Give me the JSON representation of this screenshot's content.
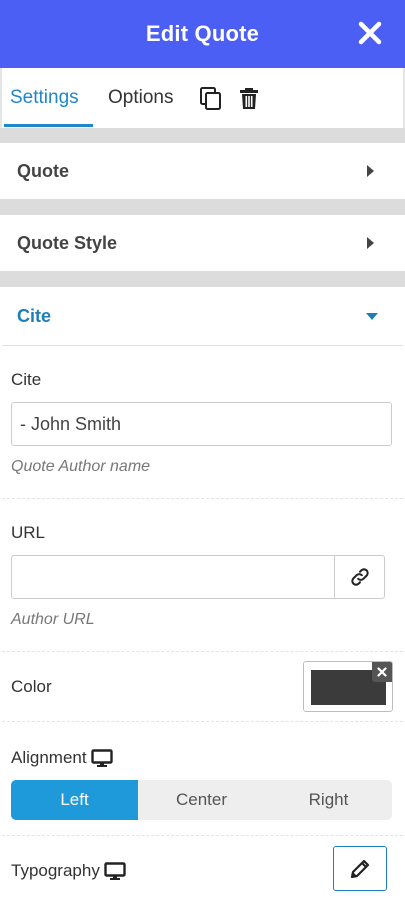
{
  "header": {
    "title": "Edit Quote",
    "close_icon": "close-icon"
  },
  "tabs": {
    "settings": "Settings",
    "options": "Options",
    "active": "settings",
    "accent_color": "#1e88c8"
  },
  "toolbar": {
    "duplicate_icon": "copy-icon",
    "delete_icon": "trash-icon"
  },
  "sections": {
    "quote": {
      "title": "Quote",
      "expanded": false
    },
    "quote_style": {
      "title": "Quote Style",
      "expanded": false
    },
    "cite": {
      "title": "Cite",
      "expanded": true
    }
  },
  "cite_panel": {
    "cite": {
      "label": "Cite",
      "value": "- John Smith",
      "description": "Quote Author name"
    },
    "url": {
      "label": "URL",
      "value": "",
      "description": "Author URL",
      "link_icon": "link-icon"
    },
    "color": {
      "label": "Color",
      "value": "#3b3b3b"
    },
    "alignment": {
      "label": "Alignment",
      "device_icon": "desktop-icon",
      "options": [
        "Left",
        "Center",
        "Right"
      ],
      "selected": "Left"
    },
    "typography": {
      "label": "Typography",
      "device_icon": "desktop-icon",
      "edit_icon": "pencil-icon"
    }
  },
  "colors": {
    "header_bg": "#4c5ff5",
    "accent": "#1e99da",
    "separator": "#dcdcdc"
  }
}
